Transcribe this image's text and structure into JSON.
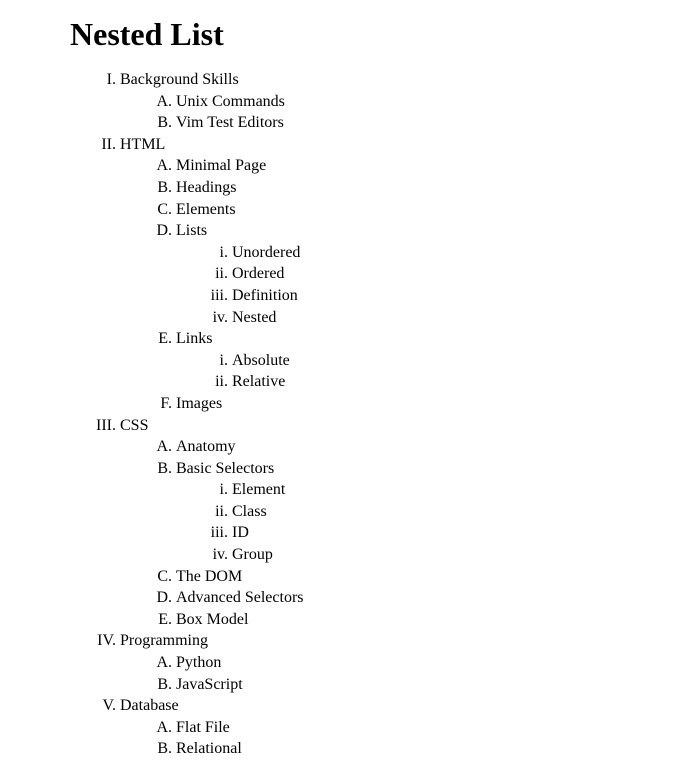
{
  "heading": "Nested List",
  "outline": [
    {
      "label": "Background Skills",
      "children": [
        {
          "label": "Unix Commands"
        },
        {
          "label": "Vim Test Editors"
        }
      ]
    },
    {
      "label": "HTML",
      "children": [
        {
          "label": "Minimal Page"
        },
        {
          "label": "Headings"
        },
        {
          "label": "Elements"
        },
        {
          "label": "Lists",
          "children": [
            {
              "label": "Unordered"
            },
            {
              "label": "Ordered"
            },
            {
              "label": "Definition"
            },
            {
              "label": "Nested"
            }
          ]
        },
        {
          "label": "Links",
          "children": [
            {
              "label": "Absolute"
            },
            {
              "label": "Relative"
            }
          ]
        },
        {
          "label": "Images"
        }
      ]
    },
    {
      "label": "CSS",
      "children": [
        {
          "label": "Anatomy"
        },
        {
          "label": "Basic Selectors",
          "children": [
            {
              "label": "Element"
            },
            {
              "label": "Class"
            },
            {
              "label": "ID"
            },
            {
              "label": "Group"
            }
          ]
        },
        {
          "label": "The DOM"
        },
        {
          "label": "Advanced Selectors"
        },
        {
          "label": "Box Model"
        }
      ]
    },
    {
      "label": "Programming",
      "children": [
        {
          "label": "Python"
        },
        {
          "label": "JavaScript"
        }
      ]
    },
    {
      "label": "Database",
      "children": [
        {
          "label": "Flat File"
        },
        {
          "label": "Relational"
        }
      ]
    }
  ]
}
